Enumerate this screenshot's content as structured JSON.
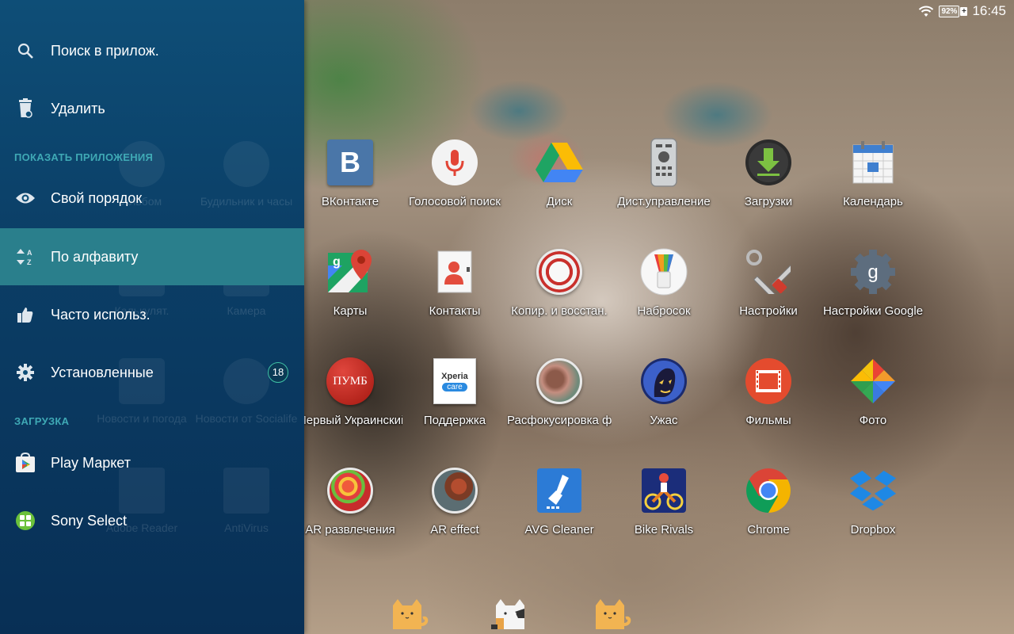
{
  "status_bar": {
    "battery_percent": "92%",
    "battery_plus": "+",
    "time": "16:45"
  },
  "drawer": {
    "items": [
      {
        "label": "Поиск в прилож.",
        "icon": "search-icon"
      },
      {
        "label": "Удалить",
        "icon": "trash-icon"
      },
      {
        "label": "Свой порядок",
        "icon": "eye-icon"
      },
      {
        "label": "По алфавиту",
        "icon": "sort-az-icon",
        "selected": true
      },
      {
        "label": "Часто использ.",
        "icon": "thumbs-up-icon"
      },
      {
        "label": "Установленные",
        "icon": "gear-icon",
        "badge": "18"
      },
      {
        "label": "Play Маркет",
        "icon": "play-store-icon"
      },
      {
        "label": "Sony Select",
        "icon": "sony-select-icon"
      }
    ],
    "sections": {
      "show_apps": "ПОКАЗАТЬ ПРИЛОЖЕНИЯ",
      "download": "ЗАГРУЗКА"
    },
    "ghost_labels": [
      "Альбом",
      "Будильник и часы",
      "Калькулят.",
      "Камера",
      "Новости и погода",
      "Новости от Socialife",
      "Adobe Reader",
      "AntiVirus"
    ]
  },
  "apps": [
    {
      "label": "ВКонтакте",
      "icon": "vk-icon"
    },
    {
      "label": "Голосовой поиск",
      "icon": "voice-search-icon"
    },
    {
      "label": "Диск",
      "icon": "drive-icon"
    },
    {
      "label": "Дист.управление",
      "icon": "remote-control-icon"
    },
    {
      "label": "Загрузки",
      "icon": "downloads-icon"
    },
    {
      "label": "Календарь",
      "icon": "calendar-icon"
    },
    {
      "label": "Карты",
      "icon": "maps-icon"
    },
    {
      "label": "Контакты",
      "icon": "contacts-icon"
    },
    {
      "label": "Копир. и восстан.",
      "icon": "backup-restore-icon"
    },
    {
      "label": "Набросок",
      "icon": "sketch-icon"
    },
    {
      "label": "Настройки",
      "icon": "settings-tools-icon"
    },
    {
      "label": "Настройки Google",
      "icon": "google-settings-icon"
    },
    {
      "label": "Первый Украинский",
      "icon": "pumb-icon"
    },
    {
      "label": "Поддержка",
      "icon": "xperia-care-icon"
    },
    {
      "label": "Расфокусировка ф",
      "icon": "background-defocus-icon"
    },
    {
      "label": "Ужас",
      "icon": "horror-icon"
    },
    {
      "label": "Фильмы",
      "icon": "movies-icon"
    },
    {
      "label": "Фото",
      "icon": "photos-icon"
    },
    {
      "label": "AR развлечения",
      "icon": "ar-fun-icon"
    },
    {
      "label": "AR effect",
      "icon": "ar-effect-icon"
    },
    {
      "label": "AVG Cleaner",
      "icon": "avg-cleaner-icon"
    },
    {
      "label": "Bike Rivals",
      "icon": "bike-rivals-icon"
    },
    {
      "label": "Chrome",
      "icon": "chrome-icon"
    },
    {
      "label": "Dropbox",
      "icon": "dropbox-icon"
    }
  ],
  "icon_texts": {
    "vk": "B",
    "pumb": "ПУМБ",
    "xperia": "Xperia",
    "care": "care",
    "google_g": "g"
  },
  "colors": {
    "drawer_top": "#0e4e77",
    "drawer_bottom": "#082f55",
    "selected": "#2a7f8c",
    "section_text": "#3fa9b5"
  }
}
